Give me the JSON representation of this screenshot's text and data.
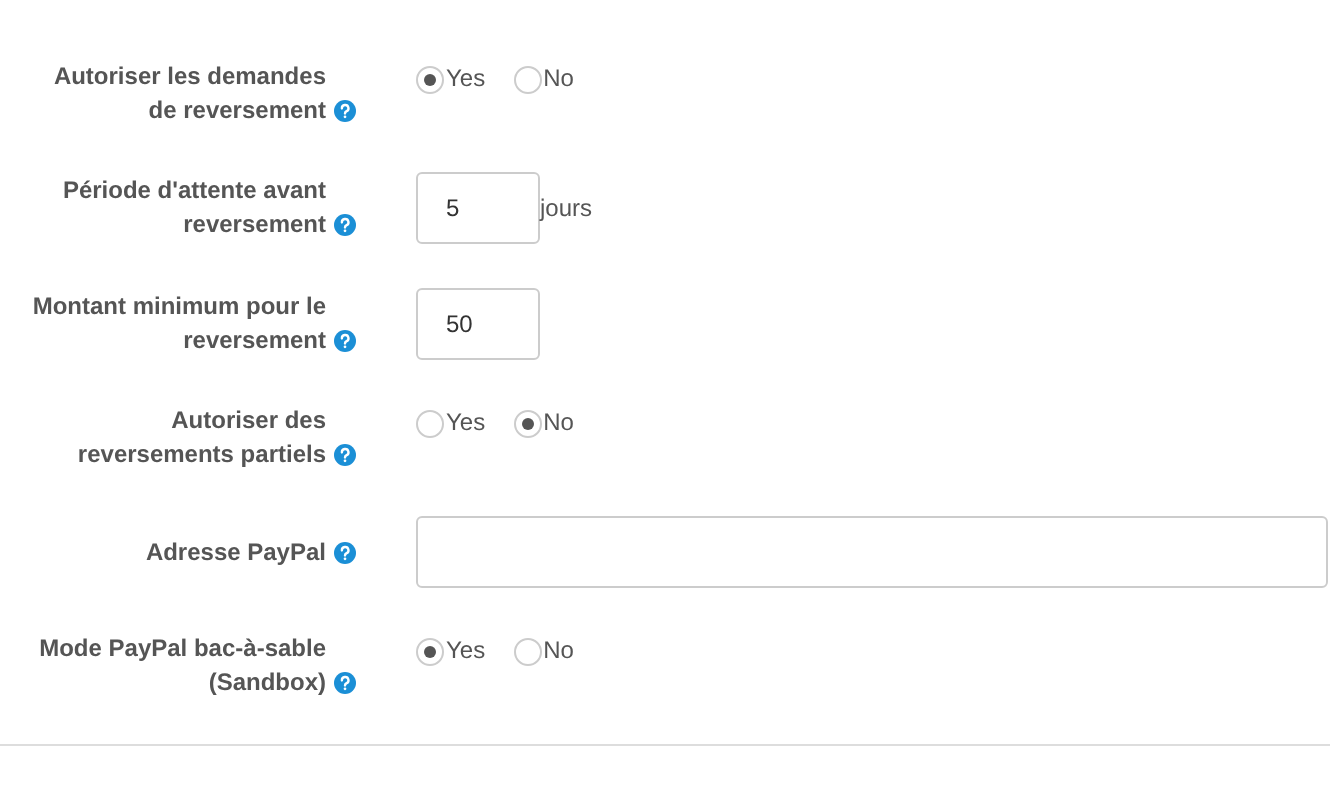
{
  "fields": [
    {
      "kind": "radio",
      "label": "Autoriser les demandes de reversement",
      "options": [
        {
          "label": "Yes",
          "selected": true
        },
        {
          "label": "No",
          "selected": false
        }
      ]
    },
    {
      "kind": "number",
      "label": "Période d'attente avant reversement",
      "value": "5",
      "suffix": "jours"
    },
    {
      "kind": "number",
      "label": "Montant minimum pour le reversement",
      "value": "50"
    },
    {
      "kind": "radio",
      "label": "Autoriser des reversements partiels",
      "options": [
        {
          "label": "Yes",
          "selected": false
        },
        {
          "label": "No",
          "selected": true
        }
      ]
    },
    {
      "kind": "text",
      "label": "Adresse PayPal"
    },
    {
      "kind": "radio",
      "label": "Mode PayPal bac-à-sable (Sandbox)",
      "options": [
        {
          "label": "Yes",
          "selected": true
        },
        {
          "label": "No",
          "selected": false
        }
      ]
    }
  ]
}
